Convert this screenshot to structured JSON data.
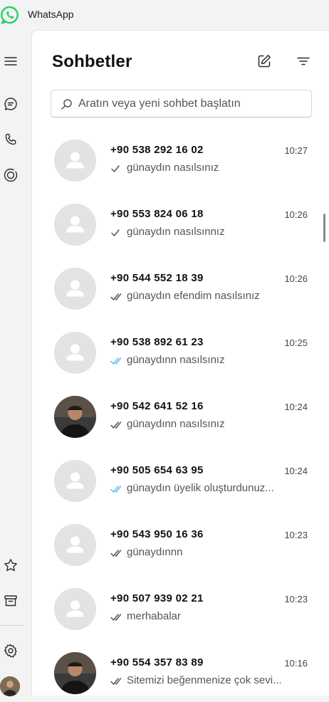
{
  "app": {
    "title": "WhatsApp",
    "accent_color": "#25d366",
    "read_tick_color": "#53bdeb",
    "sent_tick_color": "#555555"
  },
  "rail": {
    "items": [
      {
        "name": "menu-icon"
      },
      {
        "name": "chats-icon"
      },
      {
        "name": "calls-icon"
      },
      {
        "name": "status-icon"
      },
      {
        "name": "starred-icon"
      },
      {
        "name": "archived-icon"
      },
      {
        "name": "settings-icon"
      },
      {
        "name": "profile-avatar"
      }
    ]
  },
  "panel": {
    "title": "Sohbetler",
    "new_chat_icon": "edit-icon",
    "filter_icon": "filter-icon"
  },
  "search": {
    "placeholder": "Aratın veya yeni sohbet başlatın",
    "value": ""
  },
  "chats": [
    {
      "name": "+90 538 292 16 02",
      "time": "10:27",
      "preview": "günaydın nasılsınız",
      "tick": "single",
      "avatar": "default"
    },
    {
      "name": "+90 553 824 06 18",
      "time": "10:26",
      "preview": "günaydın nasılsınnız",
      "tick": "single",
      "avatar": "default"
    },
    {
      "name": "+90 544 552 18 39",
      "time": "10:26",
      "preview": "günaydın efendim nasılsınız",
      "tick": "double",
      "avatar": "default"
    },
    {
      "name": "+90 538 892 61 23",
      "time": "10:25",
      "preview": "günaydınn nasılsınız",
      "tick": "read",
      "avatar": "default"
    },
    {
      "name": "+90 542 641 52 16",
      "time": "10:24",
      "preview": "günaydınn nasılsınız",
      "tick": "double",
      "avatar": "photo"
    },
    {
      "name": "+90 505 654 63 95",
      "time": "10:24",
      "preview": "günaydın üyelik oluşturdunuz...",
      "tick": "read",
      "avatar": "default"
    },
    {
      "name": "+90 543 950 16 36",
      "time": "10:23",
      "preview": "günaydınnn",
      "tick": "double",
      "avatar": "default"
    },
    {
      "name": "+90 507 939 02 21",
      "time": "10:23",
      "preview": "merhabalar",
      "tick": "double",
      "avatar": "default"
    },
    {
      "name": "+90 554 357 83 89",
      "time": "10:16",
      "preview": "Sitemizi beğenmenize çok sevi...",
      "tick": "double",
      "avatar": "photo"
    }
  ]
}
